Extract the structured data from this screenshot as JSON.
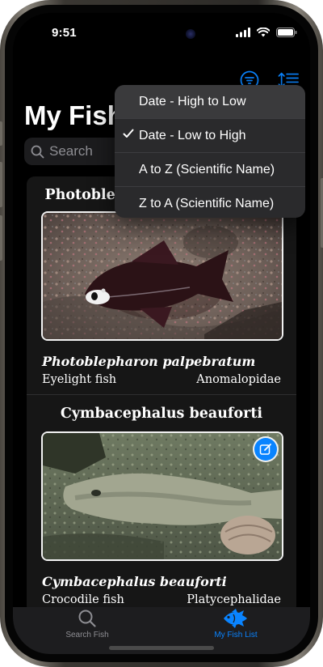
{
  "status_bar": {
    "time": "9:51"
  },
  "header": {
    "title": "My Fish"
  },
  "search": {
    "placeholder": "Search"
  },
  "sort_menu": {
    "items": [
      {
        "label": "Date - High to Low",
        "checked": false,
        "highlighted": true
      },
      {
        "label": "Date - Low to High",
        "checked": true,
        "highlighted": false
      },
      {
        "label": "A to Z (Scientific Name)",
        "checked": false,
        "highlighted": false
      },
      {
        "label": "Z to A (Scientific Name)",
        "checked": false,
        "highlighted": false
      }
    ]
  },
  "fish": [
    {
      "title": "Photoblepharon palpebratum",
      "scientific_name": "Photoblepharon palpebratum",
      "common_name": "Eyelight fish",
      "family": "Anomalopidae",
      "photo_icon": "eyelight-fish-photo"
    },
    {
      "title": "Cymbacephalus beauforti",
      "scientific_name": "Cymbacephalus beauforti",
      "common_name": "Crocodile fish",
      "family": "Platycephalidae",
      "photo_icon": "crocodile-fish-photo"
    }
  ],
  "tabs": [
    {
      "label": "Search Fish",
      "icon": "magnifier-icon",
      "active": false
    },
    {
      "label": "My Fish List",
      "icon": "fish-icon",
      "active": true
    }
  ],
  "colors": {
    "accent": "#0a84ff",
    "background": "#000000",
    "card": "#161616",
    "menu": "#2a2a2c",
    "inactive_tab": "#8e8e93"
  }
}
